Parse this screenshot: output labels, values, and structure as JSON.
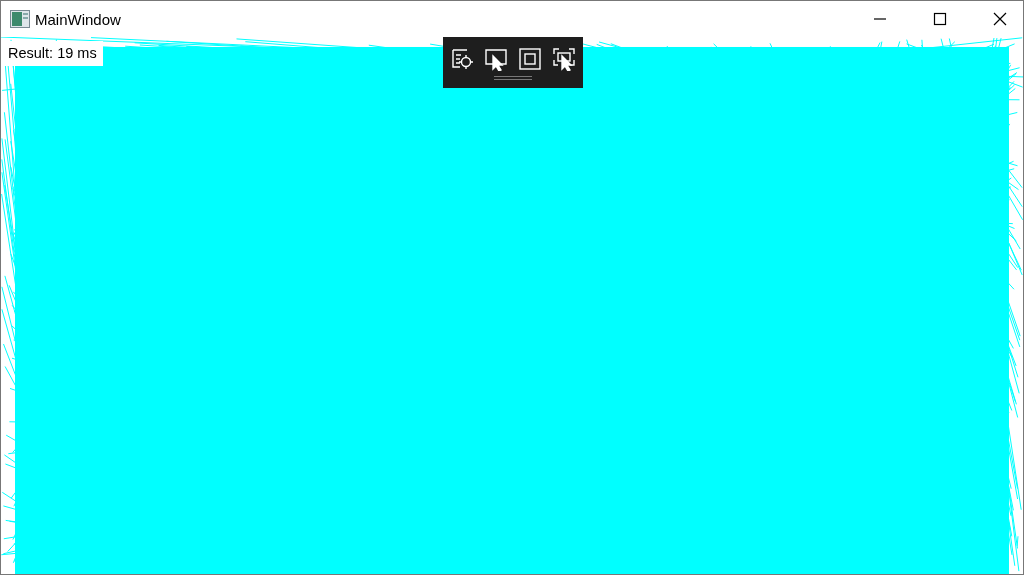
{
  "window": {
    "title": "MainWindow"
  },
  "result_label": {
    "text": "Result: 19 ms"
  }
}
